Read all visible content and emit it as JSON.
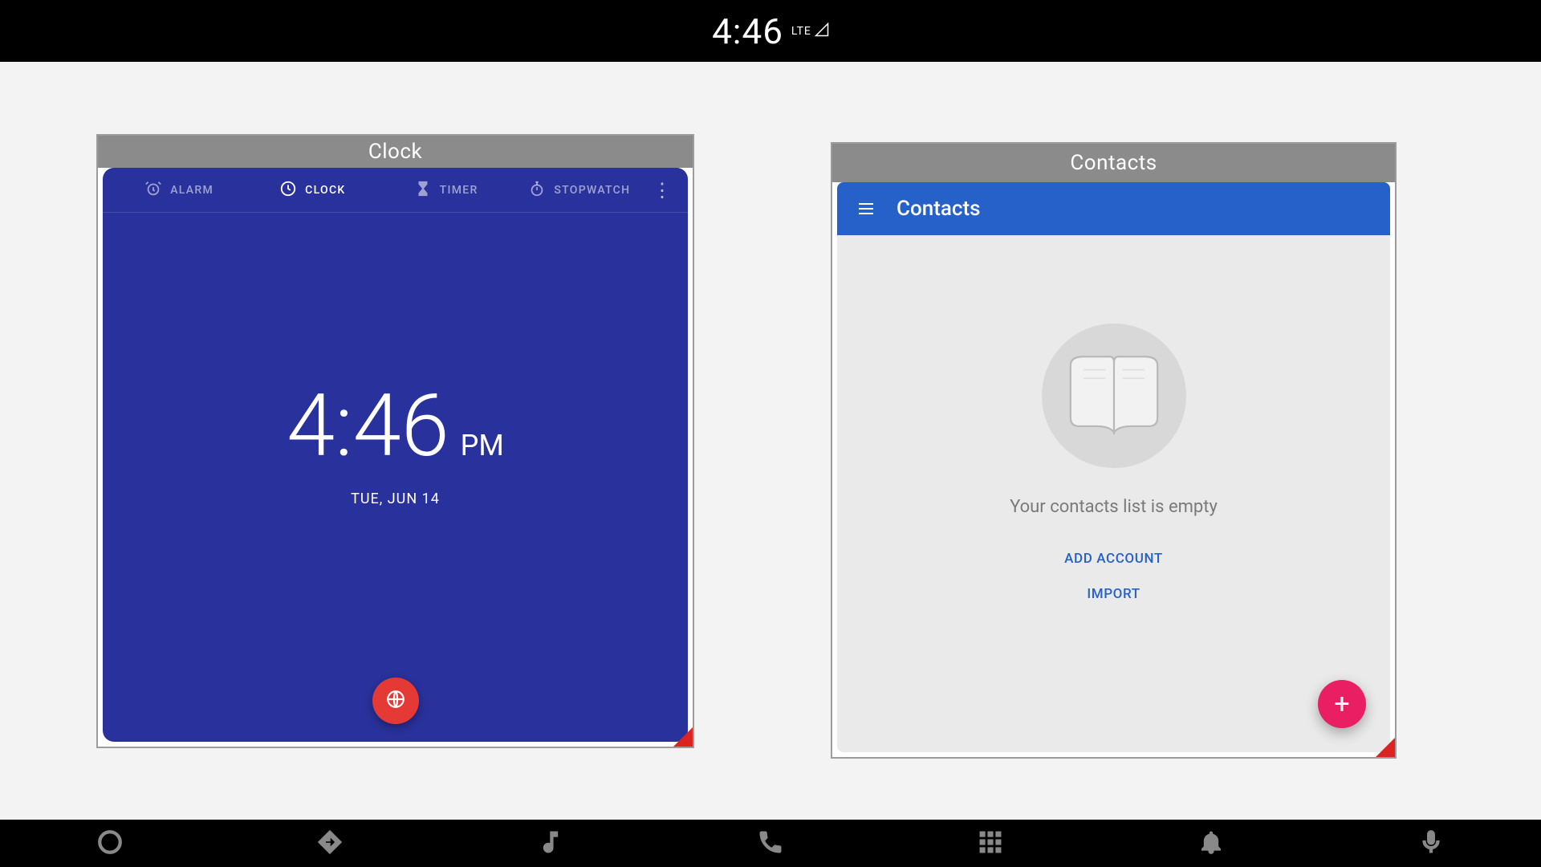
{
  "status_bar": {
    "time": "4:46",
    "network_label": "LTE"
  },
  "windows": {
    "clock": {
      "title": "Clock",
      "tabs": {
        "alarm": "ALARM",
        "clock": "CLOCK",
        "timer": "TIMER",
        "stopwatch": "STOPWATCH"
      },
      "active_tab": "clock",
      "display_time": "4:46",
      "ampm": "PM",
      "date": "TUE, JUN 14"
    },
    "contacts": {
      "title": "Contacts",
      "toolbar_title": "Contacts",
      "empty_message": "Your contacts list is empty",
      "add_account_label": "ADD ACCOUNT",
      "import_label": "IMPORT",
      "fab_label": "+"
    }
  },
  "bottom_nav": {
    "items": [
      {
        "name": "circle"
      },
      {
        "name": "navigation"
      },
      {
        "name": "music"
      },
      {
        "name": "phone"
      },
      {
        "name": "app-grid"
      },
      {
        "name": "notifications"
      },
      {
        "name": "mic"
      }
    ]
  }
}
